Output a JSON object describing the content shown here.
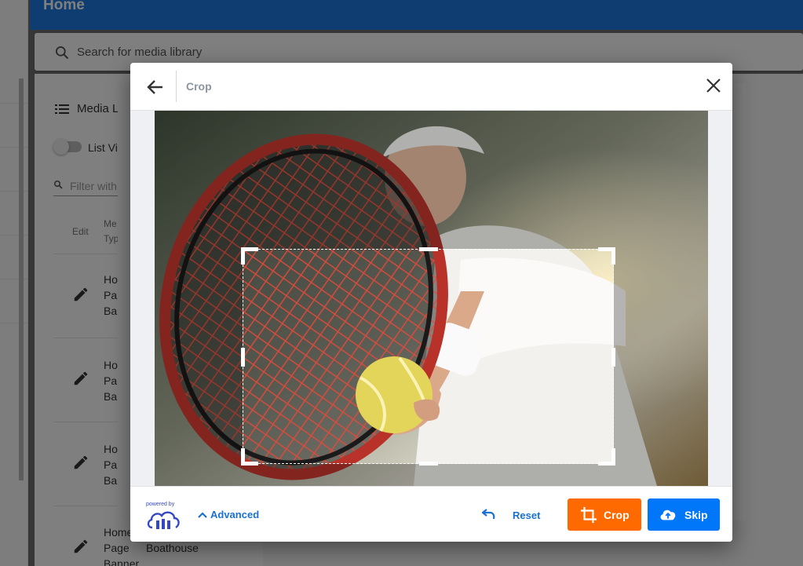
{
  "app": {
    "header_title": "Home",
    "search_placeholder": "Search for media library",
    "panel_title": "Media L",
    "list_view_label": "List Vi",
    "filter_placeholder": "Filter with",
    "columns": {
      "edit": "Edit",
      "media_type_1": "Me",
      "media_type_2": "Typ"
    },
    "rows": [
      {
        "l1": "Ho",
        "l2": "Pa",
        "l3": "Ba"
      },
      {
        "l1": "Ho",
        "l2": "Pa",
        "l3": "Ba"
      },
      {
        "l1": "Ho",
        "l2": "Pa",
        "l3": "Ba"
      },
      {
        "l1": "Home",
        "l2": "Page",
        "l3": "Banner",
        "name": "Boathouse"
      }
    ]
  },
  "dialog": {
    "title": "Crop",
    "powered_by": "powered by",
    "advanced_label": "Advanced",
    "reset_label": "Reset",
    "crop_label": "Crop",
    "skip_label": "Skip"
  },
  "colors": {
    "header_blue": "#1e7be3",
    "crop_orange": "#fe6a00",
    "skip_blue": "#0076f9",
    "link_blue": "#1971d4",
    "title_gray": "#8c95a0"
  },
  "icons": {
    "back": "arrow-left-icon",
    "close": "close-icon",
    "advanced": "chevron-up-icon",
    "reset": "undo-icon",
    "crop": "crop-icon",
    "skip": "cloud-upload-icon",
    "logo": "cloudinary-logo"
  }
}
